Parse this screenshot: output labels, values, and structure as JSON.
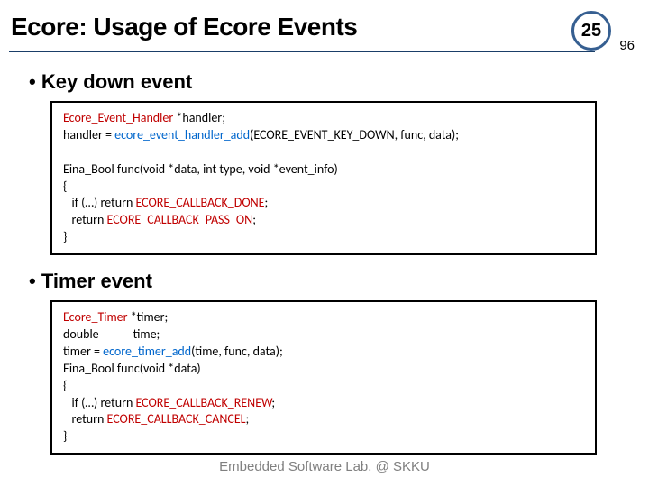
{
  "slide": {
    "title": "Ecore: Usage of Ecore Events",
    "page_current": "25",
    "page_total": "96"
  },
  "bullets": {
    "keydown": "Key down event",
    "timer": "Timer event"
  },
  "code1": {
    "t1a": "Ecore_Event_Handler",
    "t1b": " *handler;",
    "t2a": "handler = ",
    "t2b": "ecore_event_handler_add",
    "t2c": "(ECORE_EVENT_KEY_DOWN, func, data);",
    "blank1": "",
    "t3a": "Eina_Bool func(void *data, int type, void *event_info)",
    "t4": "{",
    "t5a": "   if (…) return ",
    "t5b": "ECORE_CALLBACK_DONE",
    "t5c": ";",
    "t6a": "   return ",
    "t6b": "ECORE_CALLBACK_PASS_ON",
    "t6c": ";",
    "t7": "}"
  },
  "code2": {
    "t1a": "Ecore_Timer",
    "t1b": " *timer;",
    "t2": "double            time;",
    "t3a": "timer = ",
    "t3b": "ecore_timer_add",
    "t3c": "(time, func, data);",
    "t4": "Eina_Bool func(void *data)",
    "t5": "{",
    "t6a": "   if (…) return ",
    "t6b": "ECORE_CALLBACK_RENEW",
    "t6c": ";",
    "t7a": "   return ",
    "t7b": "ECORE_CALLBACK_CANCEL",
    "t7c": ";",
    "t8": "}"
  },
  "footer": "Embedded Software Lab. @ SKKU"
}
